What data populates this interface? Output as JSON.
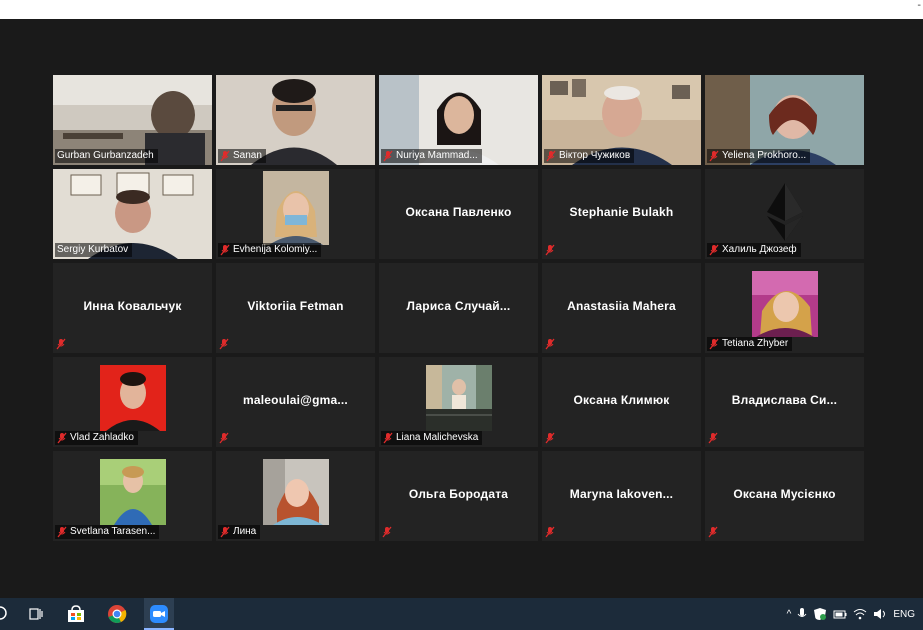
{
  "window": {
    "minimize_glyph": "-"
  },
  "colors": {
    "background": "#1a1a1a",
    "tile": "#232323",
    "active_speaker_border": "#c8e05a",
    "muted_mic": "#e02b2b",
    "taskbar": "#1c2b3a"
  },
  "participants": [
    {
      "name": "Gurban Gurbanzadeh",
      "kind": "video",
      "muted": false,
      "active": true
    },
    {
      "name": "Sanan",
      "kind": "video",
      "muted": true
    },
    {
      "name": "Nuriya Mammad...",
      "kind": "video",
      "muted": true
    },
    {
      "name": "Віктор Чужиков",
      "kind": "video",
      "muted": true
    },
    {
      "name": "Yeliena Prokhoro...",
      "kind": "video",
      "muted": true
    },
    {
      "name": "Sergiy Kurbatov",
      "kind": "video",
      "muted": false
    },
    {
      "name": "Evhenija Kolomiy...",
      "kind": "avatar",
      "muted": true
    },
    {
      "name": "Оксана Павленко",
      "kind": "text",
      "muted": false
    },
    {
      "name": "Stephanie Bulakh",
      "kind": "text",
      "muted": true
    },
    {
      "name": "Халиль Джозеф",
      "kind": "avatar",
      "muted": true
    },
    {
      "name": "Инна Ковальчук",
      "kind": "text",
      "muted": true
    },
    {
      "name": "Viktoriia Fetman",
      "kind": "text",
      "muted": true
    },
    {
      "name": "Лариса  Случай...",
      "kind": "text",
      "muted": false
    },
    {
      "name": "Anastasiia Mahera",
      "kind": "text",
      "muted": true
    },
    {
      "name": "Tetiana Zhyber",
      "kind": "avatar",
      "muted": true
    },
    {
      "name": "Vlad Zahladko",
      "kind": "avatar",
      "muted": true
    },
    {
      "name": "maleoulai@gma...",
      "kind": "text",
      "muted": true
    },
    {
      "name": "Liana Malichevska",
      "kind": "avatar",
      "muted": true
    },
    {
      "name": "Оксана Климюк",
      "kind": "text",
      "muted": true
    },
    {
      "name": "Владислава  Си...",
      "kind": "text",
      "muted": true
    },
    {
      "name": "Svetlana Tarasen...",
      "kind": "avatar",
      "muted": true
    },
    {
      "name": "Лина",
      "kind": "avatar",
      "muted": true
    },
    {
      "name": "Ольга Бородата",
      "kind": "text",
      "muted": true
    },
    {
      "name": "Maryna  Iakoven...",
      "kind": "text",
      "muted": true
    },
    {
      "name": "Оксана Мусієнко",
      "kind": "text",
      "muted": true
    }
  ],
  "taskbar": {
    "apps": [
      "task-view-icon",
      "store-icon",
      "chrome-icon",
      "zoom-icon"
    ],
    "tray": {
      "chevron": "^",
      "language": "ENG"
    }
  }
}
